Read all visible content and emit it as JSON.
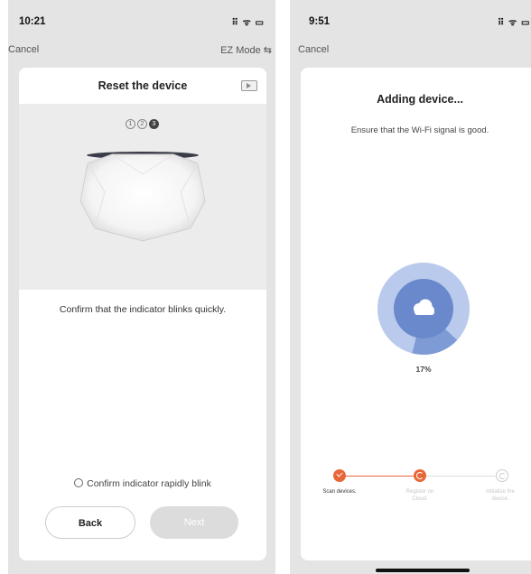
{
  "left": {
    "status": {
      "time": "10:21",
      "icons": "⠿ ᯤ ▭"
    },
    "nav": {
      "cancel": "Cancel",
      "mode": "EZ Mode ⇆"
    },
    "title": "Reset the device",
    "steps": [
      "1",
      "2",
      "3"
    ],
    "instruction": "Confirm that the indicator blinks quickly.",
    "confirm_label": "Confirm indicator rapidly blink",
    "back_label": "Back",
    "next_label": "Next"
  },
  "right": {
    "status": {
      "time": "9:51",
      "icons": "⠿ ᯤ ▭"
    },
    "nav": {
      "cancel": "Cancel"
    },
    "title": "Adding device...",
    "subtitle": "Ensure that the Wi-Fi signal is good.",
    "progress_percent": 17,
    "progress_label": "17%",
    "steps": [
      {
        "label": "Scan devices.",
        "state": "done"
      },
      {
        "label": "Register on Cloud.",
        "state": "active"
      },
      {
        "label": "Initialize the device.",
        "state": "pending"
      }
    ]
  },
  "colors": {
    "accent": "#e8673a",
    "progress_blue": "#6b8dd0",
    "light_blue": "#b7c8ec"
  }
}
